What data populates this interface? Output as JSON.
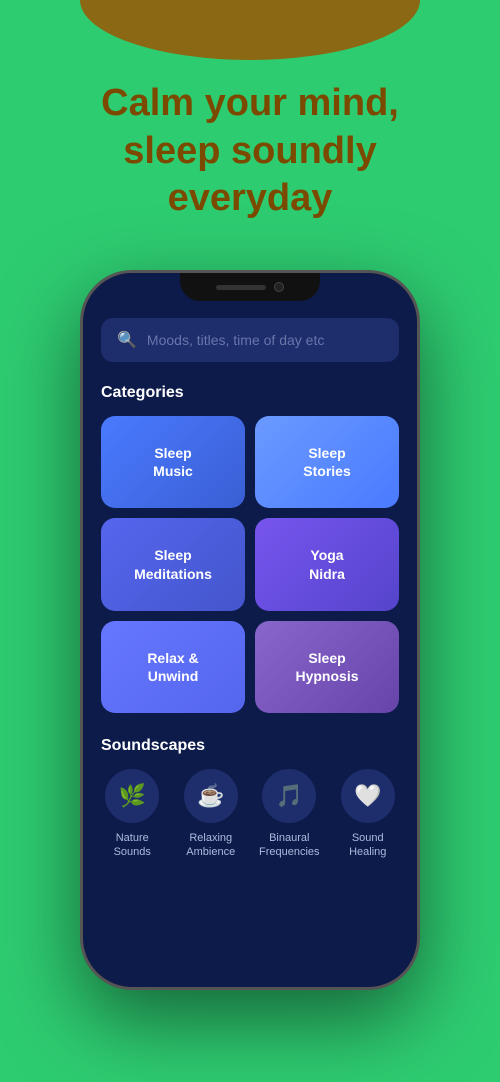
{
  "hero": {
    "title_line1": "Calm your mind,",
    "title_line2": "sleep soundly",
    "title_line3": "everyday"
  },
  "phone": {
    "search": {
      "placeholder": "Moods, titles, time of day etc"
    },
    "categories_section": {
      "title": "Categories",
      "cards": [
        {
          "label": "Sleep\nMusic",
          "style": "sleep-music"
        },
        {
          "label": "Sleep\nStories",
          "style": "sleep-stories"
        },
        {
          "label": "Sleep\nMeditations",
          "style": "sleep-med"
        },
        {
          "label": "Yoga\nNidra",
          "style": "yoga"
        },
        {
          "label": "Relax &\nUnwind",
          "style": "relax"
        },
        {
          "label": "Sleep\nHypnosis",
          "style": "hypnosis"
        }
      ]
    },
    "soundscapes_section": {
      "title": "Soundscapes",
      "items": [
        {
          "icon": "🌿",
          "label": "Nature\nSounds"
        },
        {
          "icon": "☕",
          "label": "Relaxing\nAmbience"
        },
        {
          "icon": "🎵",
          "label": "Binaural\nFrequencies"
        },
        {
          "icon": "🤍",
          "label": "Sound\nHealing"
        }
      ]
    }
  },
  "colors": {
    "background": "#2ecc71",
    "hero_text": "#7B4A00",
    "phone_bg": "#0d1b4b"
  }
}
